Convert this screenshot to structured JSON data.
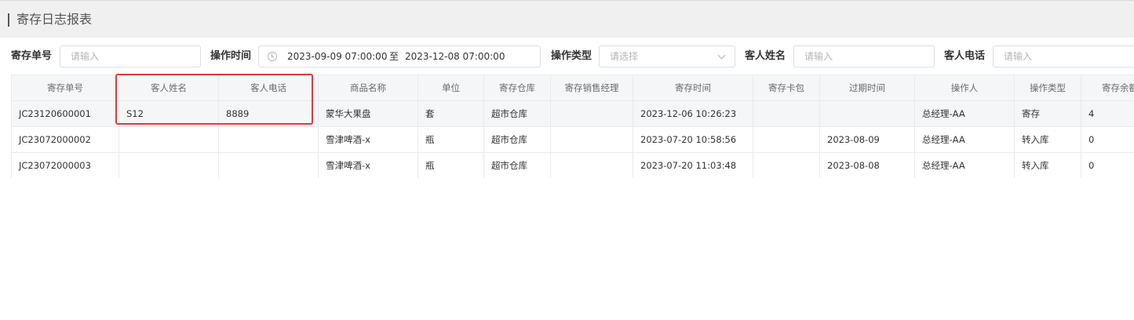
{
  "header": {
    "title": "寄存日志报表"
  },
  "filters": {
    "order_no": {
      "label": "寄存单号",
      "placeholder": "请输入"
    },
    "op_time": {
      "label": "操作时间",
      "start": "2023-09-09 07:00:00",
      "separator": "至",
      "end": "2023-12-08 07:00:00"
    },
    "op_type": {
      "label": "操作类型",
      "placeholder": "请选择"
    },
    "guest_name": {
      "label": "客人姓名",
      "placeholder": "请输入"
    },
    "guest_phone": {
      "label": "客人电话",
      "placeholder": "请输入"
    }
  },
  "table": {
    "columns": [
      "寄存单号",
      "客人姓名",
      "客人电话",
      "商品名称",
      "单位",
      "寄存仓库",
      "寄存销售经理",
      "寄存时间",
      "寄存卡包",
      "过期时间",
      "操作人",
      "操作类型",
      "寄存余额"
    ],
    "rows": [
      [
        "JC23120600001",
        "S12",
        "8889",
        "蒙华大果盘",
        "套",
        "超市仓库",
        "",
        "2023-12-06 10:26:23",
        "",
        "",
        "总经理-AA",
        "寄存",
        "4"
      ],
      [
        "JC23072000002",
        "",
        "",
        "雪津啤酒-x",
        "瓶",
        "超市仓库",
        "",
        "2023-07-20 10:58:56",
        "",
        "2023-08-09",
        "总经理-AA",
        "转入库",
        "0"
      ],
      [
        "JC23072000003",
        "",
        "",
        "雪津啤酒-x",
        "瓶",
        "超市仓库",
        "",
        "2023-07-20 11:03:48",
        "",
        "2023-08-08",
        "总经理-AA",
        "转入库",
        "0"
      ]
    ]
  },
  "colors": {
    "highlight": "#e53935",
    "header_bg": "#f0f0f0",
    "table_header_bg": "#f5f6f8"
  }
}
